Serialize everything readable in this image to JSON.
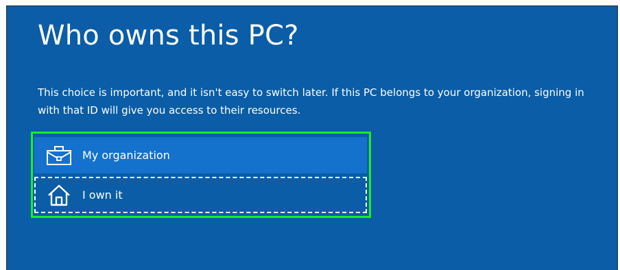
{
  "page": {
    "title": "Who owns this PC?",
    "description": "This choice is important, and it isn't easy to switch later. If this PC belongs to your organization, signing in with that ID will give you access to their resources."
  },
  "options": [
    {
      "label": "My organization",
      "icon": "briefcase-icon",
      "state": "selected"
    },
    {
      "label": "I own it",
      "icon": "home-icon",
      "state": "focused"
    }
  ],
  "colors": {
    "background": "#0a5da6",
    "selected_option": "#1471cc",
    "highlight_border": "#16f026"
  }
}
